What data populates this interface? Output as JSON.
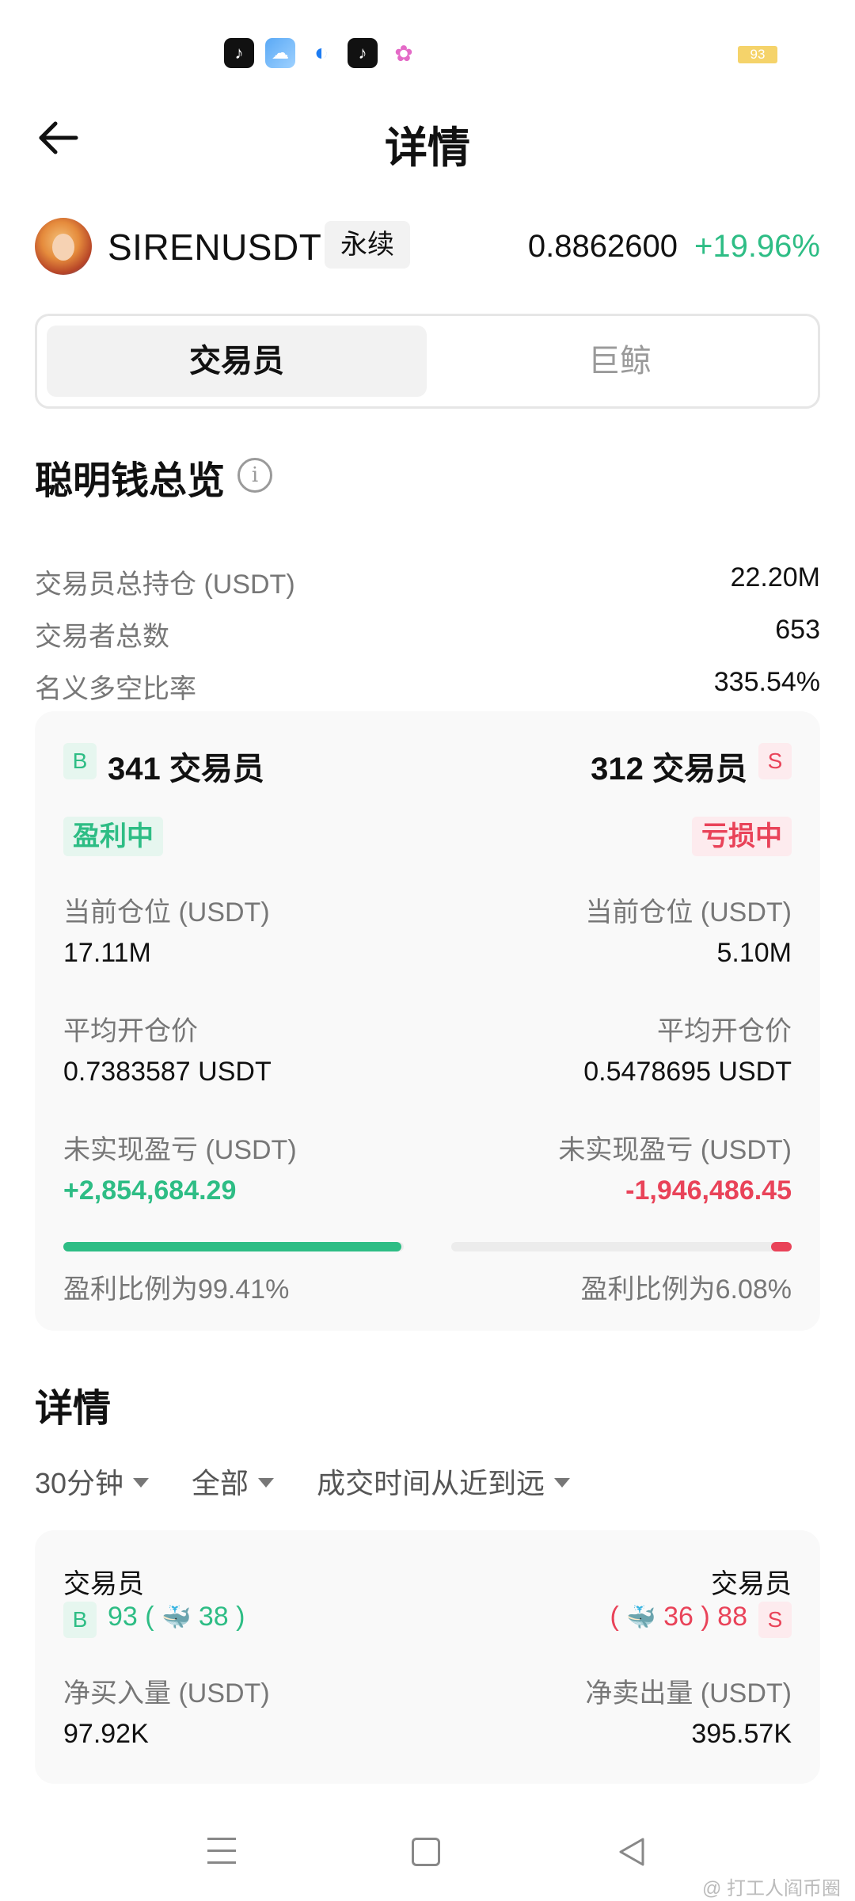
{
  "status_bar": {
    "battery": "93"
  },
  "header": {
    "title": "详情"
  },
  "symbol": {
    "name": "SIRENUSDT",
    "contract_type": "永续",
    "price": "0.8862600",
    "change": "+19.96%"
  },
  "tabs": [
    {
      "label": "交易员",
      "active": true
    },
    {
      "label": "巨鲸",
      "active": false
    }
  ],
  "overview": {
    "title": "聪明钱总览",
    "rows": [
      {
        "label": "交易员总持仓 (USDT)",
        "value": "22.20M"
      },
      {
        "label": "交易者总数",
        "value": "653"
      },
      {
        "label": "名义多空比率",
        "value": "335.54%"
      }
    ]
  },
  "long_short": {
    "long": {
      "badge": "B",
      "count": "341 交易员",
      "status": "盈利中",
      "position_label": "当前仓位 (USDT)",
      "position_value": "17.11M",
      "avg_price_label": "平均开仓价",
      "avg_price_value": "0.7383587 USDT",
      "pnl_label": "未实现盈亏 (USDT)",
      "pnl_value": "+2,854,684.29",
      "ratio_text": "盈利比例为99.41%",
      "ratio": 0.9941
    },
    "short": {
      "badge": "S",
      "count": "312 交易员",
      "status": "亏损中",
      "position_label": "当前仓位 (USDT)",
      "position_value": "5.10M",
      "avg_price_label": "平均开仓价",
      "avg_price_value": "0.5478695 USDT",
      "pnl_label": "未实现盈亏 (USDT)",
      "pnl_value": "-1,946,486.45",
      "ratio_text": "盈利比例为6.08%",
      "ratio": 0.0608
    }
  },
  "details": {
    "title": "详情",
    "filters": [
      "30分钟",
      "全部",
      "成交时间从近到远"
    ],
    "card": {
      "left_title": "交易员",
      "right_title": "交易员",
      "left_badge": "B",
      "right_badge": "S",
      "left_count": "93",
      "left_whales": "38",
      "right_count": "88",
      "right_whales": "36",
      "buy_label": "净买入量 (USDT)",
      "buy_value": "97.92K",
      "sell_label": "净卖出量 (USDT)",
      "sell_value": "395.57K"
    }
  },
  "watermark": "@ 打工人阎币圈",
  "colors": {
    "up": "#2ebd85",
    "down": "#e94359"
  }
}
